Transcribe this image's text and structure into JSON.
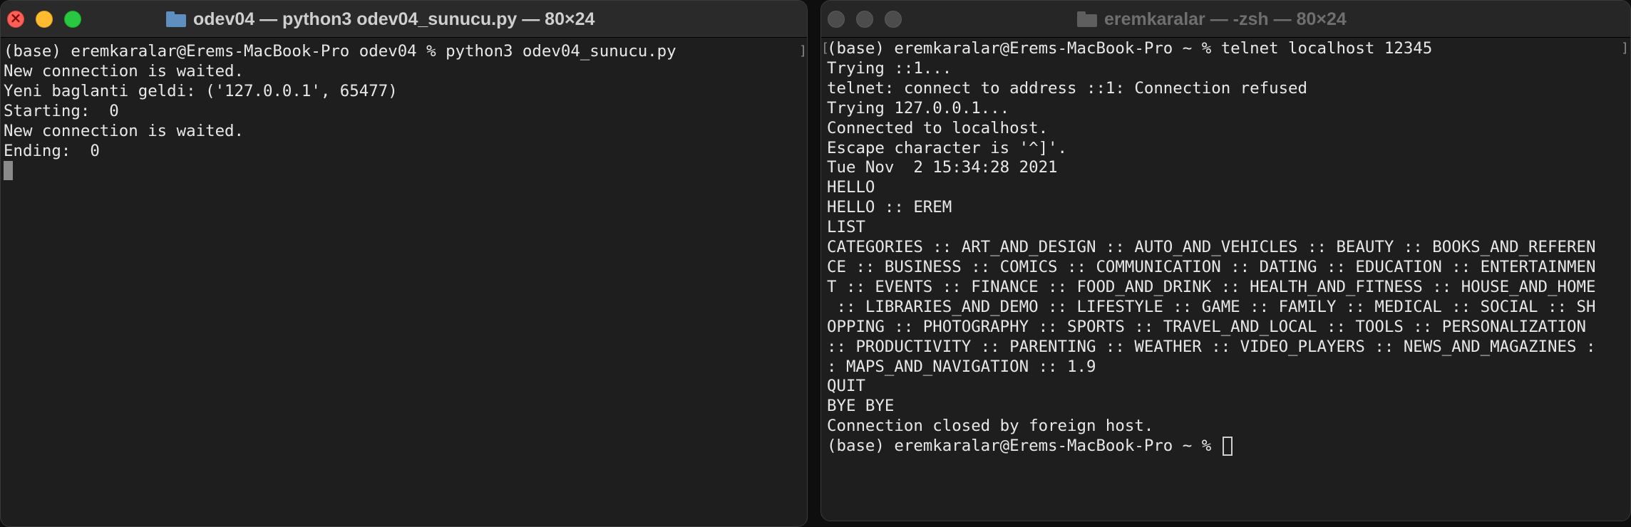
{
  "left_window": {
    "title": "odev04 — python3 odev04_sunucu.py — 80×24",
    "title_icon": "folder-icon",
    "focused": true,
    "lines": [
      "(base) eremkaralar@Erems-MacBook-Pro odev04 % python3 odev04_sunucu.py",
      "New connection is waited.",
      "Yeni baglanti geldi: ('127.0.0.1', 65477)",
      "Starting:  0",
      "New connection is waited.",
      "Ending:  0"
    ]
  },
  "right_window": {
    "title": "eremkaralar — -zsh — 80×24",
    "title_icon": "folder-icon",
    "focused": false,
    "lines": [
      "(base) eremkaralar@Erems-MacBook-Pro ~ % telnet localhost 12345",
      "Trying ::1...",
      "telnet: connect to address ::1: Connection refused",
      "Trying 127.0.0.1...",
      "Connected to localhost.",
      "Escape character is '^]'.",
      "Tue Nov  2 15:34:28 2021",
      "HELLO",
      "HELLO :: EREM",
      "LIST",
      "CATEGORIES :: ART_AND_DESIGN :: AUTO_AND_VEHICLES :: BEAUTY :: BOOKS_AND_REFEREN",
      "CE :: BUSINESS :: COMICS :: COMMUNICATION :: DATING :: EDUCATION :: ENTERTAINMEN",
      "T :: EVENTS :: FINANCE :: FOOD_AND_DRINK :: HEALTH_AND_FITNESS :: HOUSE_AND_HOME",
      " :: LIBRARIES_AND_DEMO :: LIFESTYLE :: GAME :: FAMILY :: MEDICAL :: SOCIAL :: SH",
      "OPPING :: PHOTOGRAPHY :: SPORTS :: TRAVEL_AND_LOCAL :: TOOLS :: PERSONALIZATION ",
      ":: PRODUCTIVITY :: PARENTING :: WEATHER :: VIDEO_PLAYERS :: NEWS_AND_MAGAZINES :",
      ": MAPS_AND_NAVIGATION :: 1.9",
      "QUIT",
      "BYE BYE",
      "Connection closed by foreign host.",
      "(base) eremkaralar@Erems-MacBook-Pro ~ % "
    ]
  },
  "colors": {
    "terminal_bg": "#1e1e1e",
    "terminal_fg": "#e8e8e8",
    "close": "#fe5f57",
    "minimize": "#febc2e",
    "maximize": "#28c840"
  }
}
